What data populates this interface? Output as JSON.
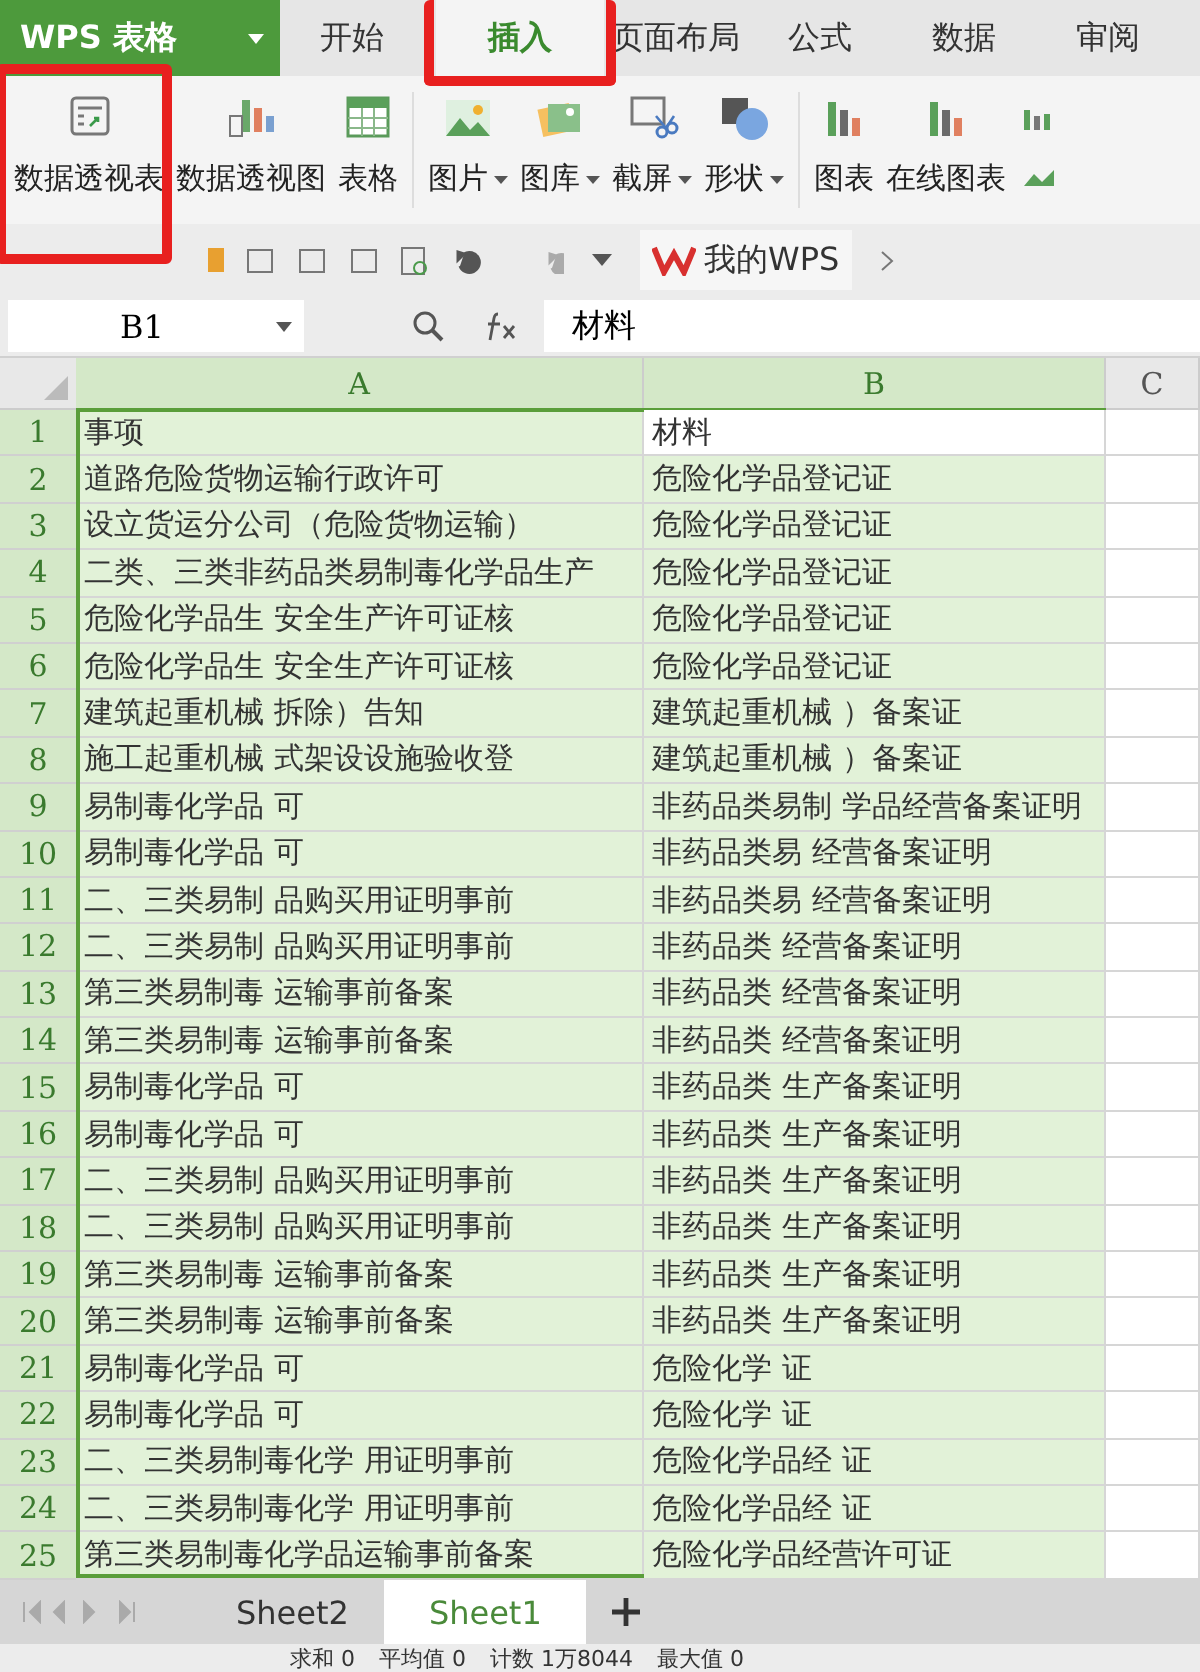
{
  "app": {
    "title": "WPS 表格"
  },
  "tabs": [
    {
      "label": "开始",
      "selected": false,
      "highlighted": false
    },
    {
      "label": "插入",
      "selected": true,
      "highlighted": true
    },
    {
      "label": "页面布局",
      "selected": false,
      "highlighted": false
    },
    {
      "label": "公式",
      "selected": false,
      "highlighted": false
    },
    {
      "label": "数据",
      "selected": false,
      "highlighted": false
    },
    {
      "label": "审阅",
      "selected": false,
      "highlighted": false
    }
  ],
  "ribbon": [
    {
      "kind": "pivot-table",
      "label": "数据透视表",
      "dropdown": false,
      "highlighted": true
    },
    {
      "kind": "pivot-chart",
      "label": "数据透视图",
      "dropdown": false,
      "highlighted": false
    },
    {
      "kind": "table",
      "label": "表格",
      "dropdown": false,
      "highlighted": false
    },
    {
      "kind": "picture",
      "label": "图片",
      "dropdown": true,
      "highlighted": false
    },
    {
      "kind": "gallery",
      "label": "图库",
      "dropdown": true,
      "highlighted": false
    },
    {
      "kind": "screenshot",
      "label": "截屏",
      "dropdown": true,
      "highlighted": false
    },
    {
      "kind": "shape",
      "label": "形状",
      "dropdown": true,
      "highlighted": false
    },
    {
      "kind": "chart",
      "label": "图表",
      "dropdown": false,
      "highlighted": false
    },
    {
      "kind": "online-chart",
      "label": "在线图表",
      "dropdown": false,
      "highlighted": false
    }
  ],
  "doc_tab": {
    "label": "我的WPS"
  },
  "formula_bar": {
    "name_box": "B1",
    "formula": "材料"
  },
  "table": {
    "columns": [
      "A",
      "B",
      "C"
    ],
    "rows": [
      {
        "number": "1",
        "selected": true,
        "cells": [
          {
            "text": "事项",
            "active": false
          },
          {
            "text": "材料",
            "active": true
          }
        ]
      },
      {
        "number": "2",
        "selected": true,
        "cells": [
          {
            "text": "道路危险货物运输行政许可",
            "active": false
          },
          {
            "text": "危险化学品登记证",
            "active": false
          }
        ]
      },
      {
        "number": "3",
        "selected": true,
        "cells": [
          {
            "text": "设立货运分公司（危险货物运输）",
            "active": false
          },
          {
            "text": "危险化学品登记证",
            "active": false
          }
        ]
      },
      {
        "number": "4",
        "selected": true,
        "cells": [
          {
            "text": "二类、三类非药品类易制毒化学品生产",
            "active": false
          },
          {
            "text": "危险化学品登记证",
            "active": false
          }
        ]
      },
      {
        "number": "5",
        "selected": true,
        "cells": [
          {
            "text": "危险化学品生 安全生产许可证核",
            "active": false
          },
          {
            "text": "危险化学品登记证",
            "active": false
          }
        ]
      },
      {
        "number": "6",
        "selected": true,
        "cells": [
          {
            "text": "危险化学品生 安全生产许可证核",
            "active": false
          },
          {
            "text": "危险化学品登记证",
            "active": false
          }
        ]
      },
      {
        "number": "7",
        "selected": true,
        "cells": [
          {
            "text": "建筑起重机械 拆除）告知",
            "active": false
          },
          {
            "text": "建筑起重机械 ）备案证",
            "active": false
          }
        ]
      },
      {
        "number": "8",
        "selected": true,
        "cells": [
          {
            "text": "施工起重机械 式架设设施验收登",
            "active": false
          },
          {
            "text": "建筑起重机械 ）备案证",
            "active": false
          }
        ]
      },
      {
        "number": "9",
        "selected": true,
        "cells": [
          {
            "text": "易制毒化学品 可",
            "active": false
          },
          {
            "text": "非药品类易制 学品经营备案证明",
            "active": false
          }
        ]
      },
      {
        "number": "10",
        "selected": true,
        "cells": [
          {
            "text": "易制毒化学品 可",
            "active": false
          },
          {
            "text": "非药品类易 经营备案证明",
            "active": false
          }
        ]
      },
      {
        "number": "11",
        "selected": true,
        "cells": [
          {
            "text": "二、三类易制 品购买用证明事前",
            "active": false
          },
          {
            "text": "非药品类易 经营备案证明",
            "active": false
          }
        ]
      },
      {
        "number": "12",
        "selected": true,
        "cells": [
          {
            "text": "二、三类易制 品购买用证明事前",
            "active": false
          },
          {
            "text": "非药品类 经营备案证明",
            "active": false
          }
        ]
      },
      {
        "number": "13",
        "selected": true,
        "cells": [
          {
            "text": "第三类易制毒 运输事前备案",
            "active": false
          },
          {
            "text": "非药品类 经营备案证明",
            "active": false
          }
        ]
      },
      {
        "number": "14",
        "selected": true,
        "cells": [
          {
            "text": "第三类易制毒 运输事前备案",
            "active": false
          },
          {
            "text": "非药品类 经营备案证明",
            "active": false
          }
        ]
      },
      {
        "number": "15",
        "selected": true,
        "cells": [
          {
            "text": "易制毒化学品 可",
            "active": false
          },
          {
            "text": "非药品类 生产备案证明",
            "active": false
          }
        ]
      },
      {
        "number": "16",
        "selected": true,
        "cells": [
          {
            "text": "易制毒化学品 可",
            "active": false
          },
          {
            "text": "非药品类 生产备案证明",
            "active": false
          }
        ]
      },
      {
        "number": "17",
        "selected": true,
        "cells": [
          {
            "text": "二、三类易制 品购买用证明事前",
            "active": false
          },
          {
            "text": "非药品类 生产备案证明",
            "active": false
          }
        ]
      },
      {
        "number": "18",
        "selected": true,
        "cells": [
          {
            "text": "二、三类易制 品购买用证明事前",
            "active": false
          },
          {
            "text": "非药品类 生产备案证明",
            "active": false
          }
        ]
      },
      {
        "number": "19",
        "selected": true,
        "cells": [
          {
            "text": "第三类易制毒 运输事前备案",
            "active": false
          },
          {
            "text": "非药品类 生产备案证明",
            "active": false
          }
        ]
      },
      {
        "number": "20",
        "selected": true,
        "cells": [
          {
            "text": "第三类易制毒 运输事前备案",
            "active": false
          },
          {
            "text": "非药品类 生产备案证明",
            "active": false
          }
        ]
      },
      {
        "number": "21",
        "selected": true,
        "cells": [
          {
            "text": "易制毒化学品 可",
            "active": false
          },
          {
            "text": "危险化学 证",
            "active": false
          }
        ]
      },
      {
        "number": "22",
        "selected": true,
        "cells": [
          {
            "text": "易制毒化学品 可",
            "active": false
          },
          {
            "text": "危险化学 证",
            "active": false
          }
        ]
      },
      {
        "number": "23",
        "selected": true,
        "cells": [
          {
            "text": "二、三类易制毒化学 用证明事前",
            "active": false
          },
          {
            "text": "危险化学品经 证",
            "active": false
          }
        ]
      },
      {
        "number": "24",
        "selected": true,
        "cells": [
          {
            "text": "二、三类易制毒化学 用证明事前",
            "active": false
          },
          {
            "text": "危险化学品经 证",
            "active": false
          }
        ]
      },
      {
        "number": "25",
        "selected": true,
        "cells": [
          {
            "text": "第三类易制毒化学品运输事前备案",
            "active": false
          },
          {
            "text": "危险化学品经营许可证",
            "active": false
          }
        ]
      }
    ]
  },
  "sheets": [
    {
      "label": "Sheet2",
      "selected": false
    },
    {
      "label": "Sheet1",
      "selected": true
    }
  ],
  "status_bar": [
    "求和 0",
    "平均值 0",
    "计数 1万8044",
    "最大值 0"
  ]
}
